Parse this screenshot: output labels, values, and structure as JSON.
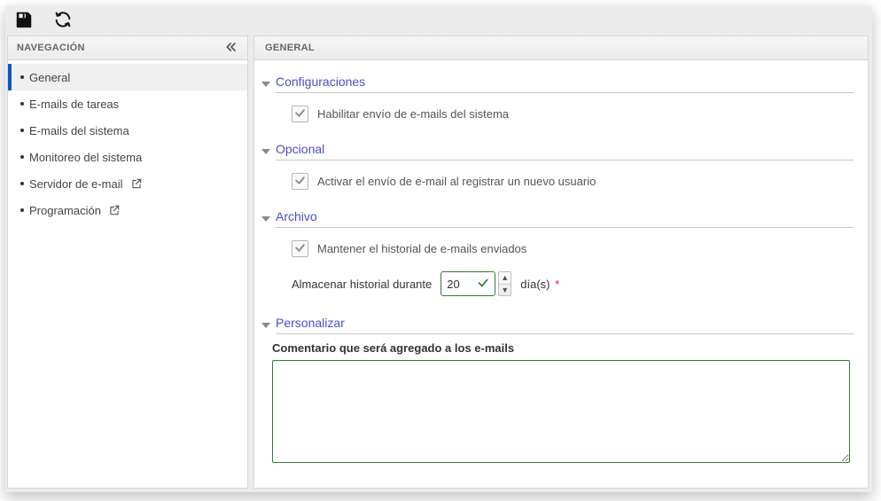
{
  "toolbar": {
    "save_title": "Guardar",
    "refresh_title": "Refrescar"
  },
  "sidebar": {
    "header": "NAVEGACIÓN",
    "items": [
      {
        "label": "General",
        "external": false,
        "active": true
      },
      {
        "label": "E-mails de tareas",
        "external": false,
        "active": false
      },
      {
        "label": "E-mails del sistema",
        "external": false,
        "active": false
      },
      {
        "label": "Monitoreo del sistema",
        "external": false,
        "active": false
      },
      {
        "label": "Servidor de e-mail",
        "external": true,
        "active": false
      },
      {
        "label": "Programación",
        "external": true,
        "active": false
      }
    ]
  },
  "main": {
    "header": "GENERAL",
    "groups": {
      "config": {
        "title": "Configuraciones",
        "enable_system_emails_label": "Habilitar envío de e-mails del sistema",
        "enable_system_emails_checked": true
      },
      "optional": {
        "title": "Opcional",
        "send_on_new_user_label": "Activar el envío de e-mail al registrar un nuevo usuario",
        "send_on_new_user_checked": true
      },
      "archive": {
        "title": "Archivo",
        "keep_history_label": "Mantener el historial de e-mails enviados",
        "keep_history_checked": true,
        "store_for_label": "Almacenar historial durante",
        "store_for_value": "20",
        "days_label": "día(s)"
      },
      "customize": {
        "title": "Personalizar",
        "comment_label": "Comentario que será agregado a los e-mails",
        "comment_value": ""
      }
    }
  }
}
